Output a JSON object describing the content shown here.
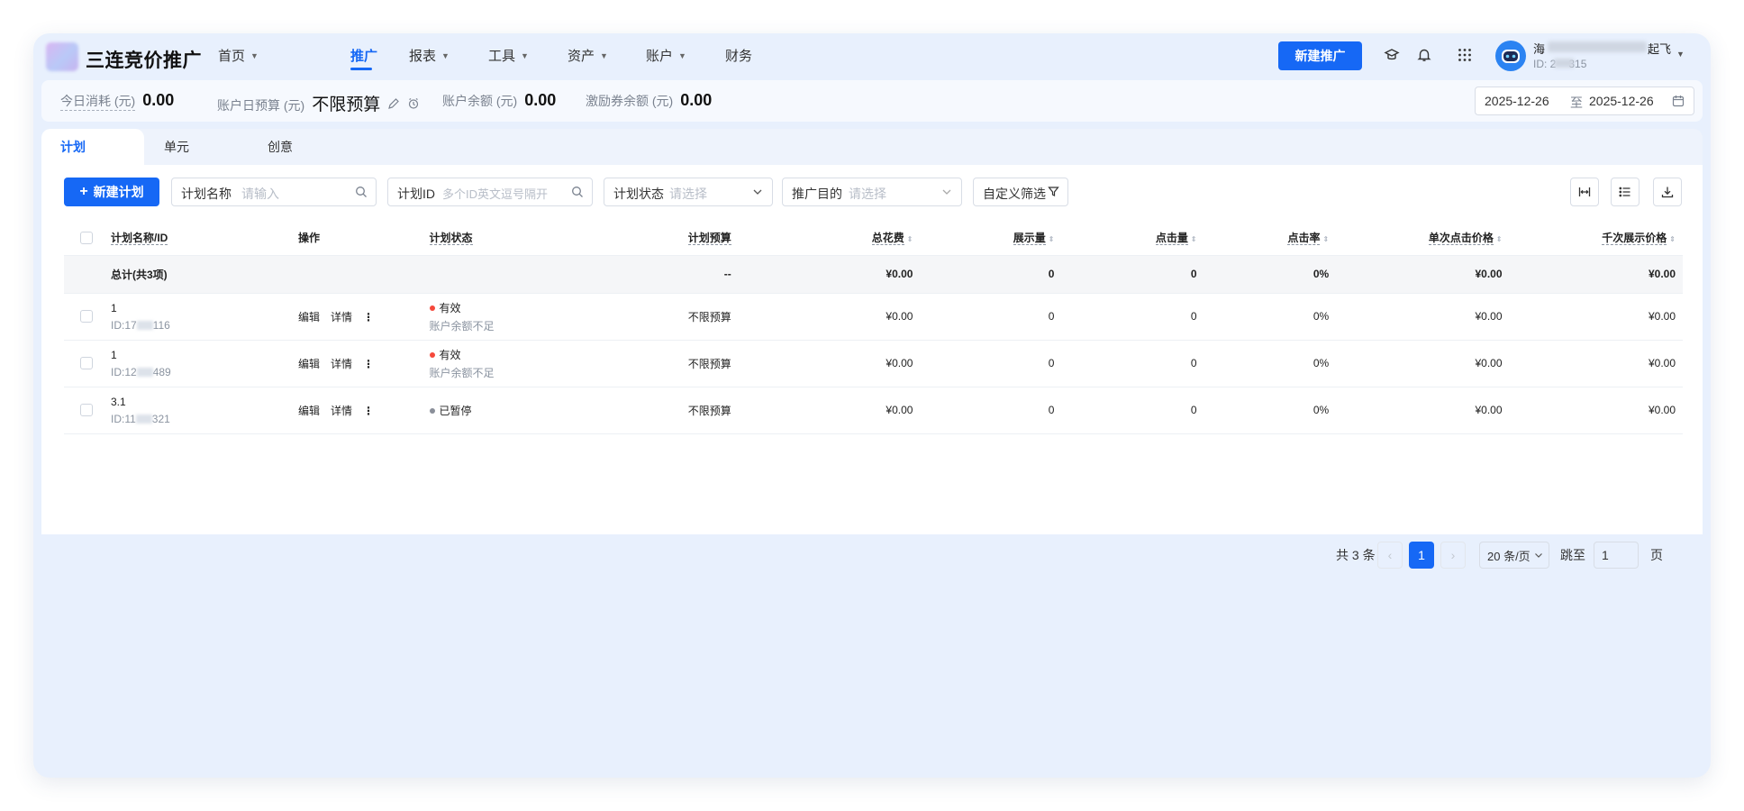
{
  "app": {
    "logo_text": "三连竞价推广"
  },
  "nav": {
    "items": [
      {
        "label": "首页",
        "caret": true
      },
      {
        "label": "推广",
        "caret": false,
        "active": true
      },
      {
        "label": "报表",
        "caret": true
      },
      {
        "label": "工具",
        "caret": true
      },
      {
        "label": "资产",
        "caret": true
      },
      {
        "label": "账户",
        "caret": true
      },
      {
        "label": "财务",
        "caret": false
      }
    ],
    "new_promo_label": "新建推广",
    "user_name_start": "海",
    "user_name_end": "起飞",
    "user_id_prefix": "ID: 2",
    "user_id_suffix": "315"
  },
  "stats": {
    "today_label": "今日消耗 (元)",
    "today_value": "0.00",
    "budget_label": "账户日预算 (元)",
    "budget_value": "不限预算",
    "balance_label": "账户余额 (元)",
    "balance_value": "0.00",
    "coupon_label": "激励券余额 (元)",
    "coupon_value": "0.00",
    "date_start": "2025-12-26",
    "date_sep": "至",
    "date_end": "2025-12-26"
  },
  "tabs": [
    "计划",
    "单元",
    "创意"
  ],
  "toolbar": {
    "new_plan_label": "新建计划",
    "name_filter_label": "计划名称",
    "name_filter_placeholder": "请输入",
    "id_filter_label": "计划ID",
    "id_filter_placeholder": "多个ID英文逗号隔开",
    "status_filter_label": "计划状态",
    "status_filter_placeholder": "请选择",
    "goal_filter_label": "推广目的",
    "goal_filter_placeholder": "请选择",
    "custom_filter_label": "自定义筛选"
  },
  "table": {
    "columns": [
      "计划名称/ID",
      "操作",
      "计划状态",
      "计划预算",
      "总花费",
      "展示量",
      "点击量",
      "点击率",
      "单次点击价格",
      "千次展示价格"
    ],
    "total": {
      "label": "总计(共3项)",
      "budget": "--",
      "cost": "¥0.00",
      "impressions": "0",
      "clicks": "0",
      "ctr": "0%",
      "cpc": "¥0.00",
      "cpm": "¥0.00"
    },
    "rows": [
      {
        "name": "1",
        "id_prefix": "ID:17",
        "id_suffix": "116",
        "edit": "编辑",
        "detail": "详情",
        "status": "有效",
        "status_color": "#f5483b",
        "status_note": "账户余额不足",
        "budget": "不限预算",
        "cost": "¥0.00",
        "impressions": "0",
        "clicks": "0",
        "ctr": "0%",
        "cpc": "¥0.00",
        "cpm": "¥0.00"
      },
      {
        "name": "1",
        "id_prefix": "ID:12",
        "id_suffix": "489",
        "edit": "编辑",
        "detail": "详情",
        "status": "有效",
        "status_color": "#f5483b",
        "status_note": "账户余额不足",
        "budget": "不限预算",
        "cost": "¥0.00",
        "impressions": "0",
        "clicks": "0",
        "ctr": "0%",
        "cpc": "¥0.00",
        "cpm": "¥0.00"
      },
      {
        "name": "3.1",
        "id_prefix": "ID:11",
        "id_suffix": "321",
        "edit": "编辑",
        "detail": "详情",
        "status": "已暂停",
        "status_color": "#8a8f99",
        "status_note": "",
        "budget": "不限预算",
        "cost": "¥0.00",
        "impressions": "0",
        "clicks": "0",
        "ctr": "0%",
        "cpc": "¥0.00",
        "cpm": "¥0.00"
      }
    ]
  },
  "pagination": {
    "total_text": "共 3 条",
    "current_page": "1",
    "page_size": "20 条/页",
    "jump_label": "跳至",
    "jump_value": "1",
    "page_unit": "页"
  },
  "colors": {
    "primary": "#1668f5",
    "app_bg": "#e8f0fd",
    "status_active": "#f5483b",
    "status_paused": "#8a8f99"
  }
}
